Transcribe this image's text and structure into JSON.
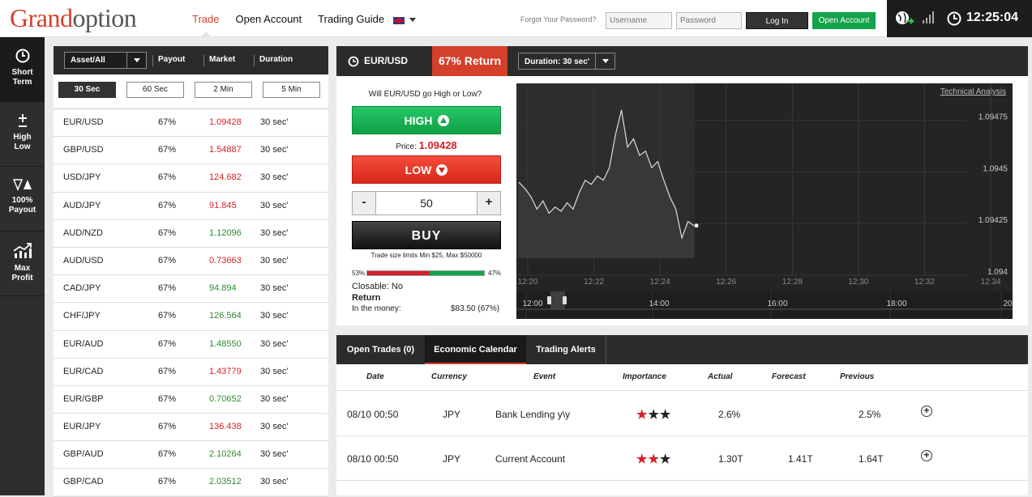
{
  "brand": {
    "part1": "Grand",
    "part2": "option"
  },
  "nav": {
    "trade": "Trade",
    "open_account": "Open Account",
    "trading_guide": "Trading Guide"
  },
  "login": {
    "forgot": "Forgot Your Password?",
    "username_placeholder": "Username",
    "password_placeholder": "Password",
    "login_label": "Log In",
    "open_account_label": "Open Account"
  },
  "clock": {
    "time": "12:25:04"
  },
  "sidebar": {
    "items": [
      {
        "line1": "Short",
        "line2": "Term",
        "icon": "clock-icon"
      },
      {
        "line1": "High",
        "line2": "Low",
        "icon": "plus-minus-icon"
      },
      {
        "line1": "100%",
        "line2": "Payout",
        "icon": "arrows-icon"
      },
      {
        "line1": "Max",
        "line2": "Profit",
        "icon": "growth-chart-icon"
      }
    ]
  },
  "assets": {
    "filter": "Asset/All",
    "columns": {
      "payout": "Payout",
      "market": "Market",
      "duration": "Duration"
    },
    "durations": [
      "30 Sec",
      "60 Sec",
      "2 Min",
      "5 Min"
    ],
    "rows": [
      {
        "pair": "EUR/USD",
        "payout": "67%",
        "price": "1.09428",
        "dir": "down",
        "dur": "30 sec'"
      },
      {
        "pair": "GBP/USD",
        "payout": "67%",
        "price": "1.54887",
        "dir": "down",
        "dur": "30 sec'"
      },
      {
        "pair": "USD/JPY",
        "payout": "67%",
        "price": "124.682",
        "dir": "down",
        "dur": "30 sec'"
      },
      {
        "pair": "AUD/JPY",
        "payout": "67%",
        "price": "91.845",
        "dir": "down",
        "dur": "30 sec'"
      },
      {
        "pair": "AUD/NZD",
        "payout": "67%",
        "price": "1.12096",
        "dir": "up",
        "dur": "30 sec'"
      },
      {
        "pair": "AUD/USD",
        "payout": "67%",
        "price": "0.73663",
        "dir": "down",
        "dur": "30 sec'"
      },
      {
        "pair": "CAD/JPY",
        "payout": "67%",
        "price": "94.894",
        "dir": "up",
        "dur": "30 sec'"
      },
      {
        "pair": "CHF/JPY",
        "payout": "67%",
        "price": "126.564",
        "dir": "up",
        "dur": "30 sec'"
      },
      {
        "pair": "EUR/AUD",
        "payout": "67%",
        "price": "1.48550",
        "dir": "up",
        "dur": "30 sec'"
      },
      {
        "pair": "EUR/CAD",
        "payout": "67%",
        "price": "1.43779",
        "dir": "down",
        "dur": "30 sec'"
      },
      {
        "pair": "EUR/GBP",
        "payout": "67%",
        "price": "0.70652",
        "dir": "up",
        "dur": "30 sec'"
      },
      {
        "pair": "EUR/JPY",
        "payout": "67%",
        "price": "136.438",
        "dir": "down",
        "dur": "30 sec'"
      },
      {
        "pair": "GBP/AUD",
        "payout": "67%",
        "price": "2.10264",
        "dir": "up",
        "dur": "30 sec'"
      },
      {
        "pair": "GBP/CAD",
        "payout": "67%",
        "price": "2.03512",
        "dir": "up",
        "dur": "30 sec'"
      }
    ]
  },
  "trade": {
    "pair": "EUR/USD",
    "return": "67% Return",
    "duration": "Duration: 30 sec'",
    "question": "Will EUR/USD go High or Low?",
    "high": "HIGH",
    "low": "LOW",
    "price_label": "Price:",
    "price": "1.09428",
    "minus": "-",
    "plus": "+",
    "amount": "50",
    "buy": "BUY",
    "limits": "Trade size limits Min $25, Max $50000",
    "low_pct": "53%",
    "high_pct": "47%",
    "low_share": 0.53,
    "closable": "Closable: No",
    "return_label": "Return",
    "in_money_label": "In the money:",
    "in_money_value": "$83.50 (67%)"
  },
  "chart_data": {
    "type": "line",
    "link": "Technical Analysis",
    "yticks": [
      "1.09475",
      "1.0945",
      "1.09425",
      "1.094"
    ],
    "xticks": [
      "12:20",
      "12:22",
      "12:24",
      "12:26",
      "12:28",
      "12:30",
      "12:32",
      "12:34"
    ],
    "nav_ticks": [
      "12:00",
      "14:00",
      "16:00",
      "18:00",
      "20"
    ],
    "ylim": [
      1.094,
      1.09485
    ],
    "x": [
      12.33,
      12.34,
      12.35,
      12.36,
      12.37,
      12.38,
      12.39,
      12.4,
      12.41,
      12.42,
      12.43,
      12.44,
      12.45,
      12.46,
      12.47,
      12.48,
      12.49,
      12.5,
      12.51,
      12.52,
      12.53,
      12.54,
      12.55,
      12.56,
      12.57,
      12.58,
      12.59,
      12.6,
      12.61,
      12.62
    ],
    "values": [
      1.09445,
      1.09442,
      1.09438,
      1.09432,
      1.09436,
      1.0943,
      1.09433,
      1.09431,
      1.09435,
      1.09432,
      1.0944,
      1.09446,
      1.09444,
      1.09448,
      1.09446,
      1.09452,
      1.09468,
      1.0948,
      1.09462,
      1.09466,
      1.09458,
      1.0946,
      1.09452,
      1.09455,
      1.09446,
      1.09438,
      1.09432,
      1.09418,
      1.09426,
      1.09424
    ]
  },
  "bottom": {
    "tabs": [
      "Open Trades  (0)",
      "Economic Calendar",
      "Trading Alerts"
    ],
    "headers": [
      "Date",
      "Currency",
      "Event",
      "Importance",
      "Actual",
      "Forecast",
      "Previous"
    ],
    "rows": [
      {
        "date": "08/10 00:50",
        "currency": "JPY",
        "event": "Bank Lending y\\y",
        "importance": 1,
        "actual": "2.6%",
        "forecast": "",
        "previous": "2.5%"
      },
      {
        "date": "08/10 00:50",
        "currency": "JPY",
        "event": "Current Account",
        "importance": 2,
        "actual": "1.30T",
        "forecast": "1.41T",
        "previous": "1.64T"
      }
    ]
  },
  "colors": {
    "accent": "#d5402b",
    "up": "#2e8b2e",
    "down": "#d4212a",
    "high_button": "#13a34a"
  }
}
